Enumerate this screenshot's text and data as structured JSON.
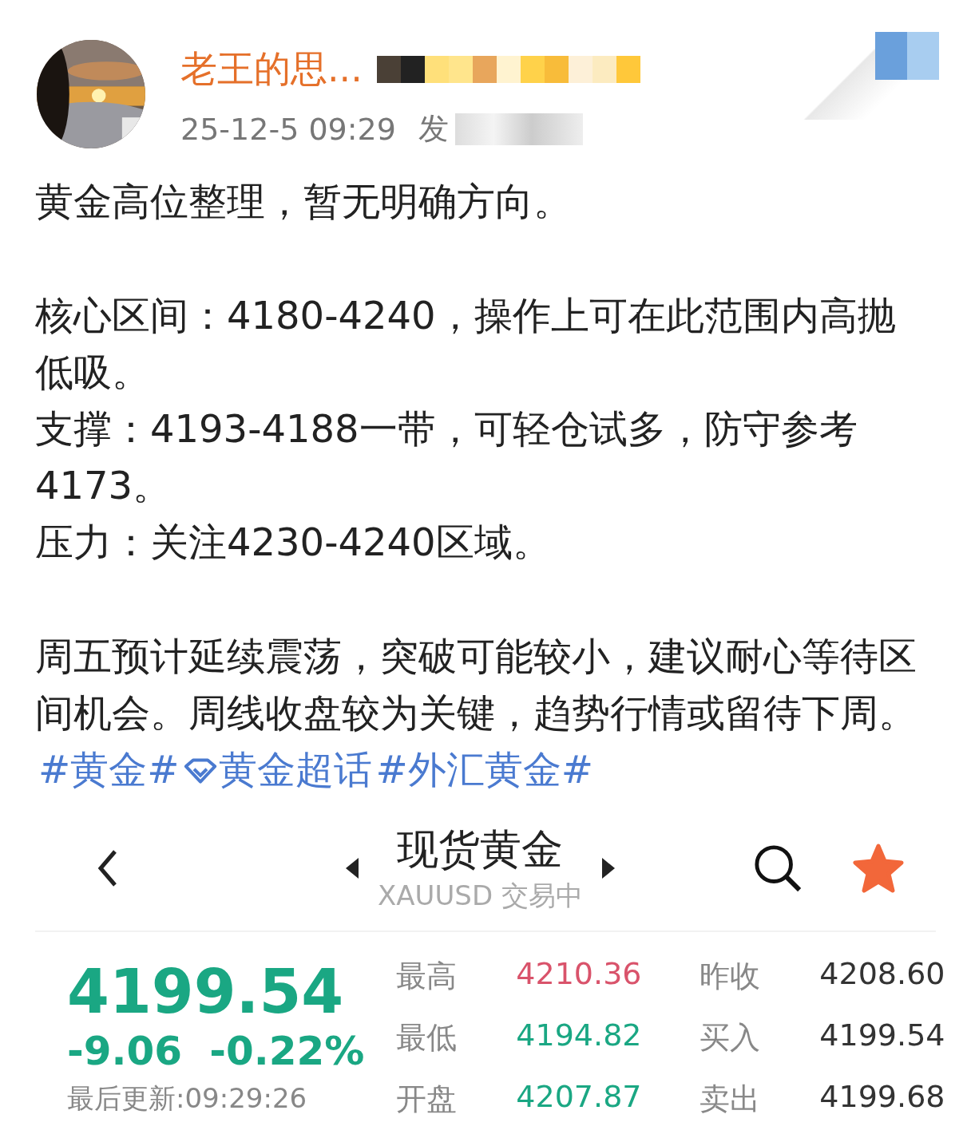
{
  "post": {
    "author": "老王的思...",
    "time": "25-12-5 09:29",
    "source": "发",
    "blocks": [
      {
        "lines": [
          "黄金高位整理，暂无明确方向。"
        ]
      },
      {
        "lines": [
          "核心区间：4180-4240，操作上可在此范围内高抛低吸。",
          "支撑：4193-4188一带，可轻仓试多，防守参考4173。",
          "压力：关注4230-4240区域。"
        ]
      },
      {
        "lines": [
          "周五预计延续震荡，突破可能较小，建议耐心等待区间机会。周线收盘较为关键，趋势行情或留待下周。"
        ],
        "tags": [
          {
            "kind": "hashtag",
            "text": "#黄金#"
          },
          {
            "kind": "supertopic",
            "text": "黄金超话"
          },
          {
            "kind": "hashtag",
            "text": "#外汇黄金#"
          }
        ]
      }
    ]
  },
  "quote": {
    "title": "现货黄金",
    "subtitle": "XAUUSD 交易中",
    "favorited": true,
    "price": "4199.54",
    "change": "-9.06",
    "percent": "-0.22%",
    "updated": "最后更新:09:29:26",
    "color": "#1aa783",
    "stats": [
      {
        "label": "最高",
        "value": "4210.36",
        "color": "#d9536b"
      },
      {
        "label": "昨收",
        "value": "4208.60",
        "color": "#333333"
      },
      {
        "label": "最低",
        "value": "4194.82",
        "color": "#1aa783"
      },
      {
        "label": "买入",
        "value": "4199.54",
        "color": "#333333"
      },
      {
        "label": "开盘",
        "value": "4207.87",
        "color": "#1aa783"
      },
      {
        "label": "卖出",
        "value": "4199.68",
        "color": "#333333"
      }
    ]
  }
}
